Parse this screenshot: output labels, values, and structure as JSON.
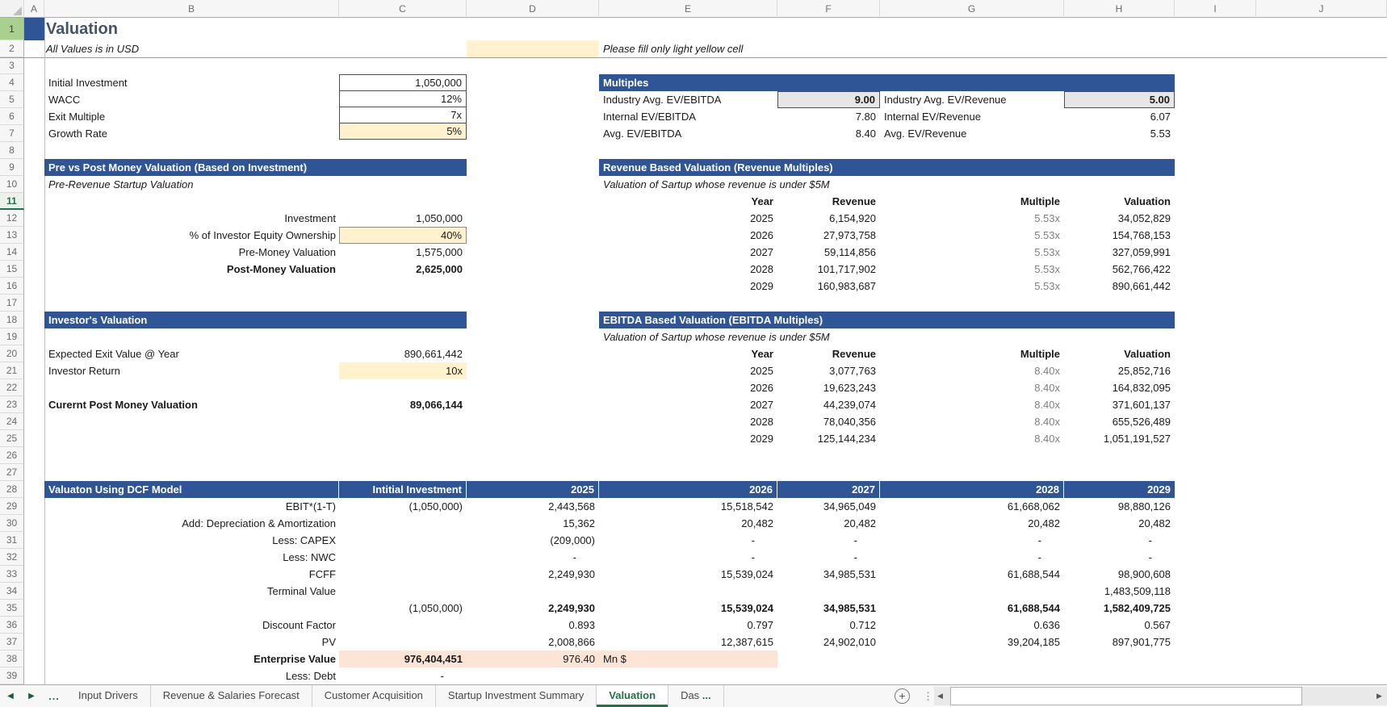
{
  "colors": {
    "accent_blue": "#2F5597",
    "title_blue": "#44546A",
    "input_yellow": "#FFF2CC",
    "input_gray": "#E7E6E6",
    "highlight_peach": "#FCE4D6",
    "tab_green": "#217346",
    "row1_header_green": "#A9D08E",
    "muted_gray": "#7F7F7F"
  },
  "grid": {
    "columns": [
      "A",
      "B",
      "C",
      "D",
      "E",
      "F",
      "G",
      "H",
      "I",
      "J"
    ],
    "rows": [
      "1",
      "2",
      "3",
      "4",
      "5",
      "6",
      "7",
      "8",
      "9",
      "10",
      "11",
      "12",
      "13",
      "14",
      "15",
      "16",
      "17",
      "18",
      "19",
      "20",
      "21",
      "22",
      "23",
      "24",
      "25",
      "26",
      "27",
      "28",
      "29",
      "30",
      "31",
      "32",
      "33",
      "34",
      "35",
      "36",
      "37",
      "38",
      "39"
    ],
    "active_row": "11"
  },
  "header": {
    "title": "Valuation",
    "subtitle": "All Values is in USD",
    "fill_note": "Please fill only light yellow cell"
  },
  "assumptions": {
    "rows": [
      {
        "label": "Initial Investment",
        "value": "1,050,000",
        "yellow": false
      },
      {
        "label": "WACC",
        "value": "12%",
        "yellow": false
      },
      {
        "label": "Exit Multiple",
        "value": "7x",
        "yellow": false
      },
      {
        "label": "Growth Rate",
        "value": "5%",
        "yellow": true
      }
    ]
  },
  "multiples": {
    "header": "Multiples",
    "rows": [
      {
        "label1": "Industry Avg. EV/EBITDA",
        "value1": "9.00",
        "boxed1": true,
        "label2": "Industry Avg. EV/Revenue",
        "value2": "5.00",
        "boxed2": true
      },
      {
        "label1": "Internal EV/EBITDA",
        "value1": "7.80",
        "boxed1": false,
        "label2": "Internal EV/Revenue",
        "value2": "6.07",
        "boxed2": false
      },
      {
        "label1": "Avg. EV/EBITDA",
        "value1": "8.40",
        "boxed1": false,
        "label2": "Avg. EV/Revenue",
        "value2": "5.53",
        "boxed2": false
      }
    ]
  },
  "pre_post": {
    "header": "Pre vs Post Money Valuation (Based on Investment)",
    "note": "Pre-Revenue Startup Valuation",
    "rows": [
      {
        "label": "Investment",
        "value": "1,050,000",
        "yellow": false,
        "bold": false
      },
      {
        "label": "% of Investor Equity Ownership",
        "value": "40%",
        "yellow": true,
        "bold": false
      },
      {
        "label": "Pre-Money Valuation",
        "value": "1,575,000",
        "yellow": false,
        "bold": false
      },
      {
        "label": "Post-Money Valuation",
        "value": "2,625,000",
        "yellow": false,
        "bold": true
      }
    ]
  },
  "revenue_valuation": {
    "header": "Revenue Based Valuation (Revenue Multiples)",
    "note": "Valuation of Sartup whose revenue is under $5M",
    "col_headers": [
      "Year",
      "Revenue",
      "Multiple",
      "Valuation"
    ],
    "rows": [
      [
        "2025",
        "6,154,920",
        "5.53x",
        "34,052,829"
      ],
      [
        "2026",
        "27,973,758",
        "5.53x",
        "154,768,153"
      ],
      [
        "2027",
        "59,114,856",
        "5.53x",
        "327,059,991"
      ],
      [
        "2028",
        "101,717,902",
        "5.53x",
        "562,766,422"
      ],
      [
        "2029",
        "160,983,687",
        "5.53x",
        "890,661,442"
      ]
    ]
  },
  "investor": {
    "header": "Investor's Valuation",
    "exit_label": "Expected Exit Value @ Year",
    "exit_value": "890,661,442",
    "return_label": "Investor Return",
    "return_value": "10x",
    "total_label": "Curernt Post Money Valuation",
    "total_value": "89,066,144"
  },
  "ebitda_valuation": {
    "header": "EBITDA Based Valuation (EBITDA Multiples)",
    "note": "Valuation of Sartup whose revenue is under $5M",
    "col_headers": [
      "Year",
      "Revenue",
      "Multiple",
      "Valuation"
    ],
    "rows": [
      [
        "2025",
        "3,077,763",
        "8.40x",
        "25,852,716"
      ],
      [
        "2026",
        "19,623,243",
        "8.40x",
        "164,832,095"
      ],
      [
        "2027",
        "44,239,074",
        "8.40x",
        "371,601,137"
      ],
      [
        "2028",
        "78,040,356",
        "8.40x",
        "655,526,489"
      ],
      [
        "2029",
        "125,144,234",
        "8.40x",
        "1,051,191,527"
      ]
    ]
  },
  "dcf": {
    "header": "Valuaton Using DCF Model",
    "col_headers": [
      "Intitial Investment",
      "2025",
      "2026",
      "2027",
      "2028",
      "2029"
    ],
    "rows": [
      {
        "label": "EBIT*(1-T)",
        "cells": [
          "(1,050,000)",
          "2,443,568",
          "15,518,542",
          "34,965,049",
          "61,668,062",
          "98,880,126"
        ],
        "cls": ""
      },
      {
        "label": "Add: Depreciation & Amortization",
        "cells": [
          "",
          "15,362",
          "20,482",
          "20,482",
          "20,482",
          "20,482"
        ],
        "cls": ""
      },
      {
        "label": "Less: CAPEX",
        "cells": [
          "",
          "(209,000)",
          "-",
          "-",
          "-",
          "-"
        ],
        "cls": ""
      },
      {
        "label": "Less: NWC",
        "cells": [
          "",
          "-",
          "-",
          "-",
          "-",
          "-"
        ],
        "cls": ""
      },
      {
        "label": "FCFF",
        "cells": [
          "",
          "2,249,930",
          "15,539,024",
          "34,985,531",
          "61,688,544",
          "98,900,608"
        ],
        "cls": ""
      },
      {
        "label": "Terminal Value",
        "cells": [
          "",
          "",
          "",
          "",
          "",
          "1,483,509,118"
        ],
        "cls": ""
      },
      {
        "label": "",
        "cells": [
          "(1,050,000)",
          "2,249,930",
          "15,539,024",
          "34,985,531",
          "61,688,544",
          "1,582,409,725"
        ],
        "cls": "sum-row"
      },
      {
        "label": "Discount Factor",
        "cells": [
          "",
          "0.893",
          "0.797",
          "0.712",
          "0.636",
          "0.567"
        ],
        "cls": ""
      },
      {
        "label": "PV",
        "cells": [
          "",
          "2,008,866",
          "12,387,615",
          "24,902,010",
          "39,204,185",
          "897,901,775"
        ],
        "cls": ""
      },
      {
        "label": "Enterprise Value",
        "cells": [
          "976,404,451",
          "976.40",
          "Mn $",
          "",
          "",
          ""
        ],
        "cls": "ev-row"
      },
      {
        "label": "Less: Debt",
        "cells": [
          "-",
          "",
          "",
          "",
          "",
          ""
        ],
        "cls": ""
      }
    ]
  },
  "tabs": {
    "nav_prev": "◀",
    "nav_next": "▶",
    "overflow": "...",
    "items": [
      {
        "label": "Input Drivers",
        "active": false,
        "ellipsis": ""
      },
      {
        "label": "Revenue & Salaries Forecast",
        "active": false,
        "ellipsis": ""
      },
      {
        "label": "Customer Acquisition",
        "active": false,
        "ellipsis": ""
      },
      {
        "label": "Startup Investment Summary",
        "active": false,
        "ellipsis": ""
      },
      {
        "label": "Valuation",
        "active": true,
        "ellipsis": ""
      },
      {
        "label": "Das",
        "active": false,
        "ellipsis": " ..."
      }
    ],
    "add_sheet": "+",
    "more_menu": "⋮",
    "scroll_left": "◀",
    "scroll_right": "▶"
  }
}
